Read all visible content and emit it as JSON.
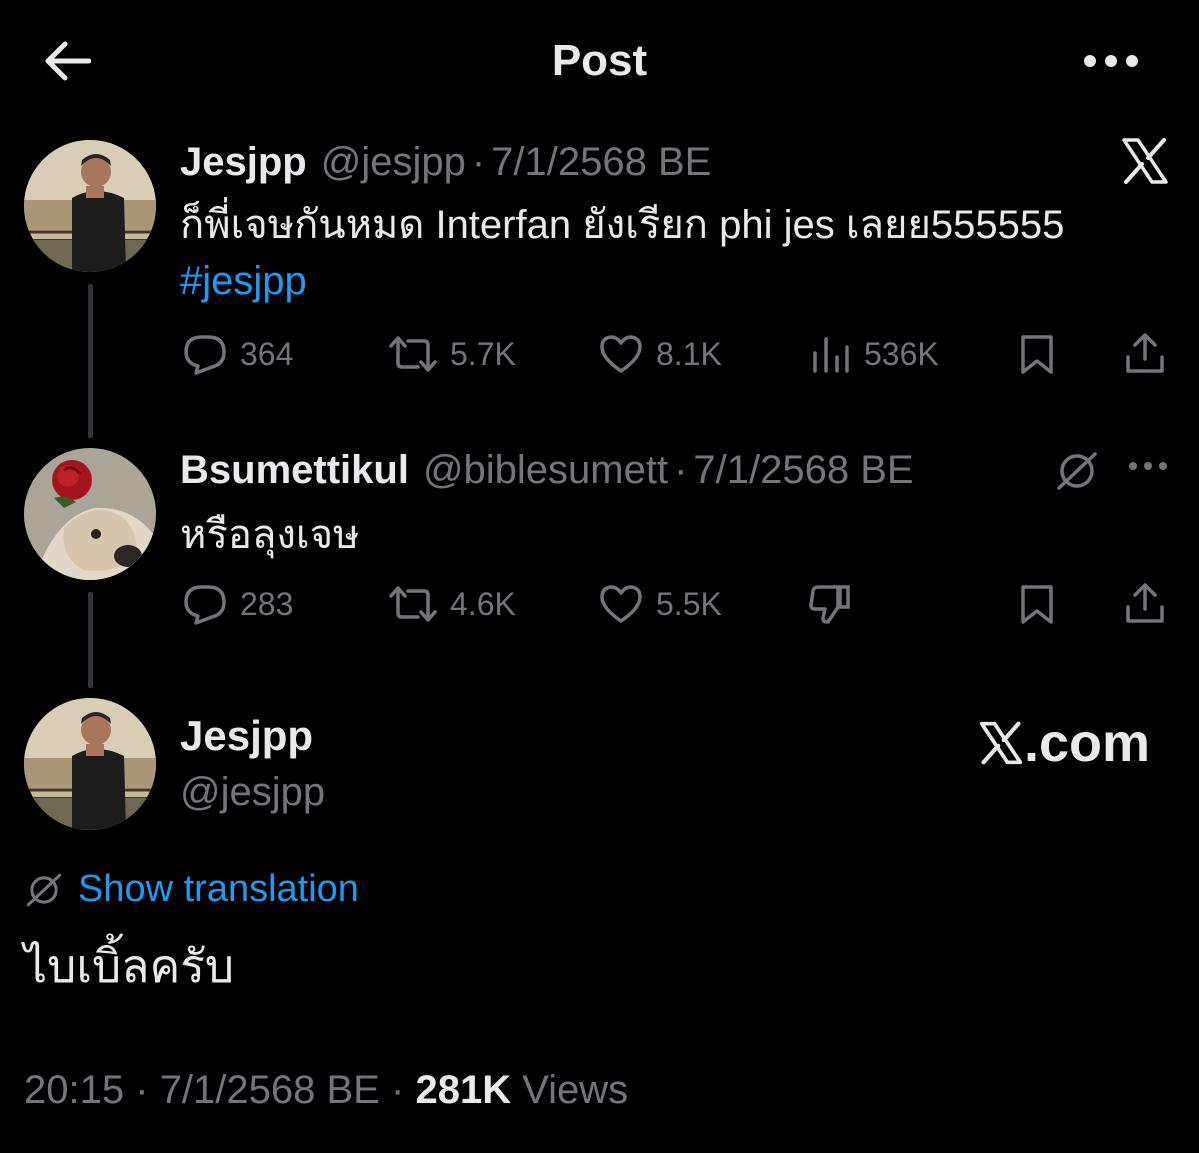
{
  "header": {
    "title": "Post",
    "back_icon": "back-arrow-icon",
    "more_icon": "more-horizontal-icon"
  },
  "tweet1": {
    "display_name": "Jesjpp",
    "handle": "@jesjpp",
    "separator": "·",
    "date": "7/1/2568 BE",
    "text": "ก็พี่เจษกันหมด Interfan ยังเรียก phi jes เลยย555555",
    "hashtag": "#jesjpp",
    "replies": "364",
    "reposts": "5.7K",
    "likes": "8.1K",
    "views": "536K"
  },
  "tweet2": {
    "display_name": "Bsumettikul",
    "handle": "@biblesumett",
    "separator": "·",
    "date": "7/1/2568 BE",
    "text": "หรือลุงเจษ",
    "replies": "283",
    "reposts": "4.6K",
    "likes": "5.5K"
  },
  "main_tweet": {
    "display_name": "Jesjpp",
    "handle": "@jesjpp",
    "show_translation": "Show translation",
    "text": "ไบเบิ้ลครับ",
    "time": "20:15",
    "separator": "·",
    "date": "7/1/2568 BE",
    "views_count": "281K",
    "views_label": "Views"
  },
  "watermark": {
    "text": ".com"
  },
  "colors": {
    "background": "#000000",
    "text": "#e7e9ea",
    "muted": "#71767b",
    "accent": "#1d9bf0"
  }
}
